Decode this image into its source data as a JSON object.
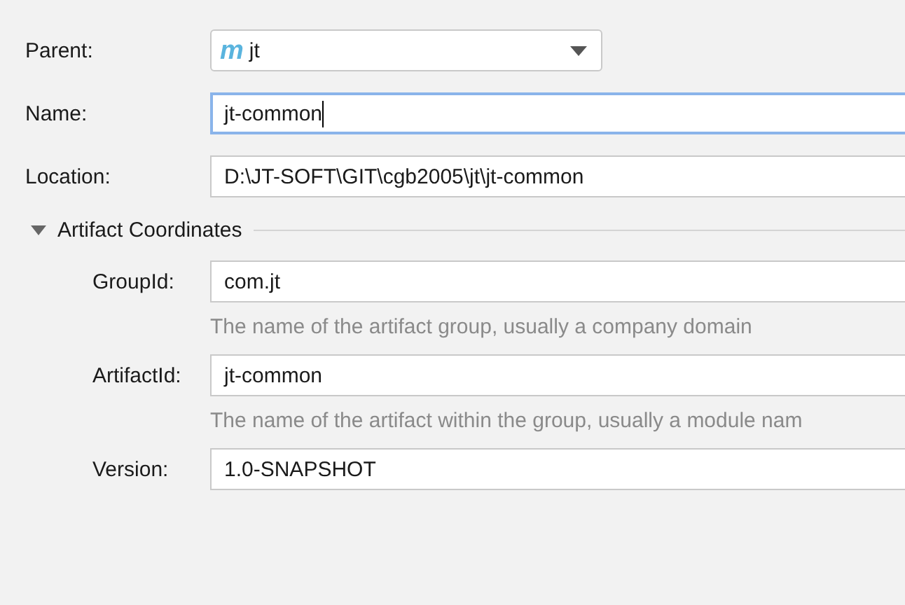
{
  "fields": [
    {
      "kind": "dropdown",
      "label": "Parent:",
      "icon": "m",
      "value": "jt"
    },
    {
      "kind": "text",
      "label": "Name:",
      "value": "jt-common",
      "focused": true
    },
    {
      "kind": "text",
      "label": "Location:",
      "value": "D:\\JT-SOFT\\GIT\\cgb2005\\jt\\jt-common",
      "focused": false
    }
  ],
  "section": {
    "title": "Artifact Coordinates",
    "expanded": true,
    "fields": [
      {
        "label": "GroupId:",
        "value": "com.jt",
        "hint": "The name of the artifact group, usually a company domain"
      },
      {
        "label": "ArtifactId:",
        "value": "jt-common",
        "hint": "The name of the artifact within the group, usually a module nam"
      },
      {
        "label": "Version:",
        "value": "1.0-SNAPSHOT"
      }
    ]
  }
}
